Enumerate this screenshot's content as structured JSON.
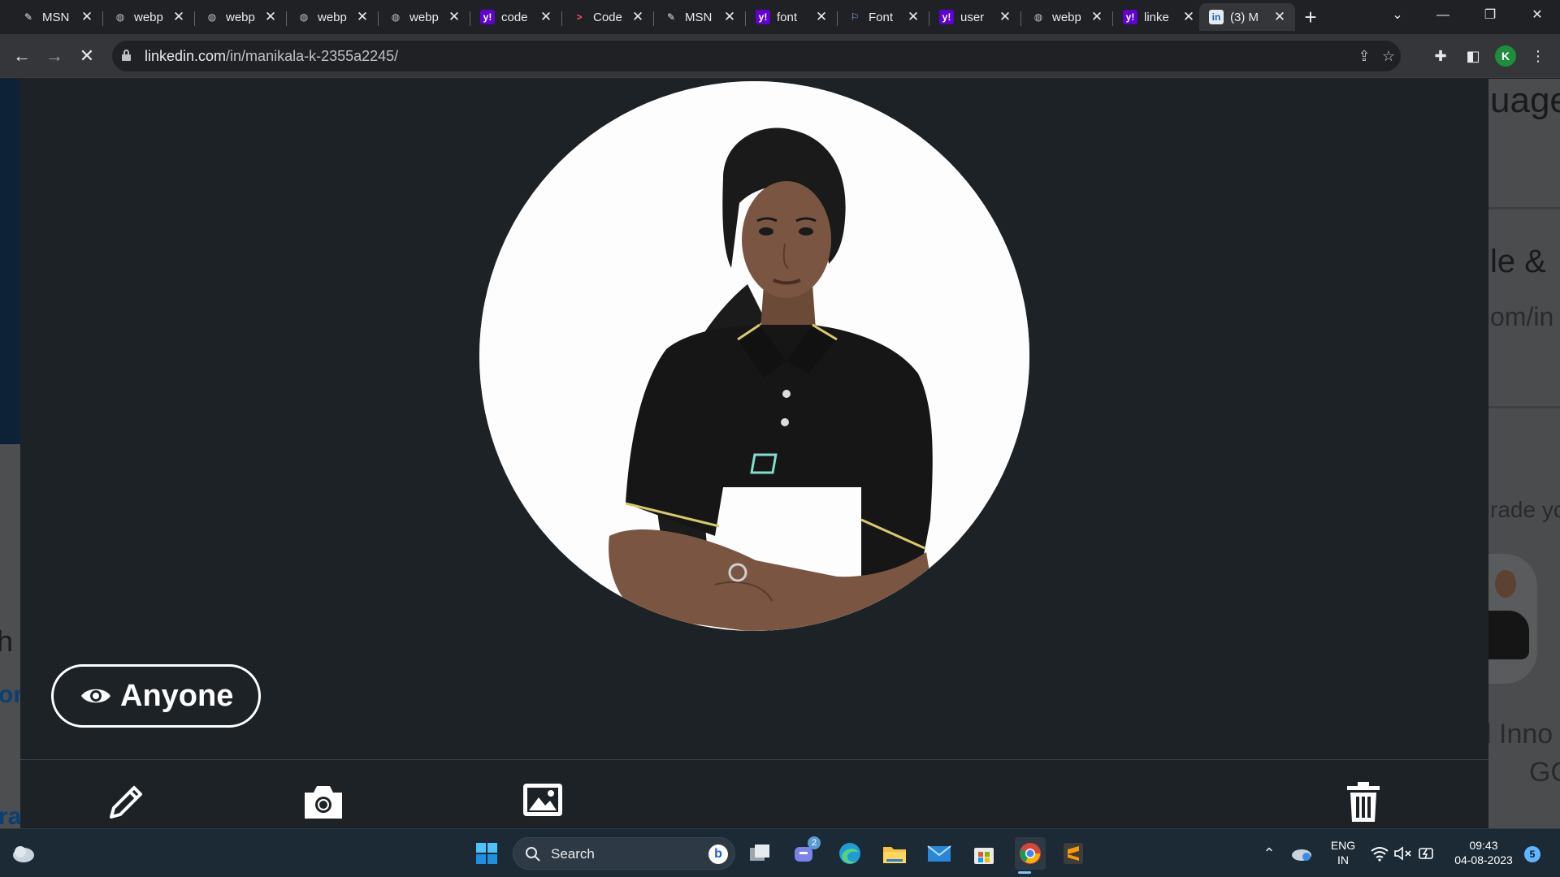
{
  "browser": {
    "tabs": [
      {
        "favicon": "msn-icon",
        "title": "MSN",
        "active": false
      },
      {
        "favicon": "globe-icon",
        "title": "webp",
        "active": false
      },
      {
        "favicon": "globe-icon",
        "title": "webp",
        "active": false
      },
      {
        "favicon": "globe-icon",
        "title": "webp",
        "active": false
      },
      {
        "favicon": "globe-icon",
        "title": "webp",
        "active": false
      },
      {
        "favicon": "yahoo-icon",
        "title": "code",
        "active": false
      },
      {
        "favicon": "code-icon",
        "title": "Code",
        "active": false
      },
      {
        "favicon": "msn-icon",
        "title": "MSN",
        "active": false
      },
      {
        "favicon": "yahoo-icon",
        "title": "font",
        "active": false
      },
      {
        "favicon": "flag-icon",
        "title": "Font",
        "active": false
      },
      {
        "favicon": "yahoo-icon",
        "title": "user",
        "active": false
      },
      {
        "favicon": "globe-icon",
        "title": "webp",
        "active": false
      },
      {
        "favicon": "yahoo-icon",
        "title": "linke",
        "active": false
      },
      {
        "favicon": "linkedin-icon",
        "title": "(3) M",
        "active": true
      }
    ],
    "url_host": "linkedin.com",
    "url_path": "/in/manikala-k-2355a2245/",
    "profile_initial": "K"
  },
  "background_page": {
    "right_fragments": [
      "uage",
      "le &",
      "om/in",
      "rade yo",
      "l Inno",
      "GO"
    ],
    "left_fragments": [
      "h",
      "or",
      "ra"
    ]
  },
  "modal": {
    "visibility_label": "Anyone",
    "actions": [
      "pencil-icon",
      "camera-icon",
      "image-icon",
      "trash-icon"
    ]
  },
  "taskbar": {
    "search_label": "Search",
    "chat_badge": "2",
    "language_line1": "ENG",
    "language_line2": "IN",
    "time": "09:43",
    "date": "04-08-2023",
    "notification_count": "5"
  },
  "colors": {
    "modal_bg": "#1d2226",
    "browser_dark": "#202124",
    "toolbar": "#35363a",
    "taskbar": "#1b2a35",
    "linkedin_blue": "#0a66c2"
  }
}
